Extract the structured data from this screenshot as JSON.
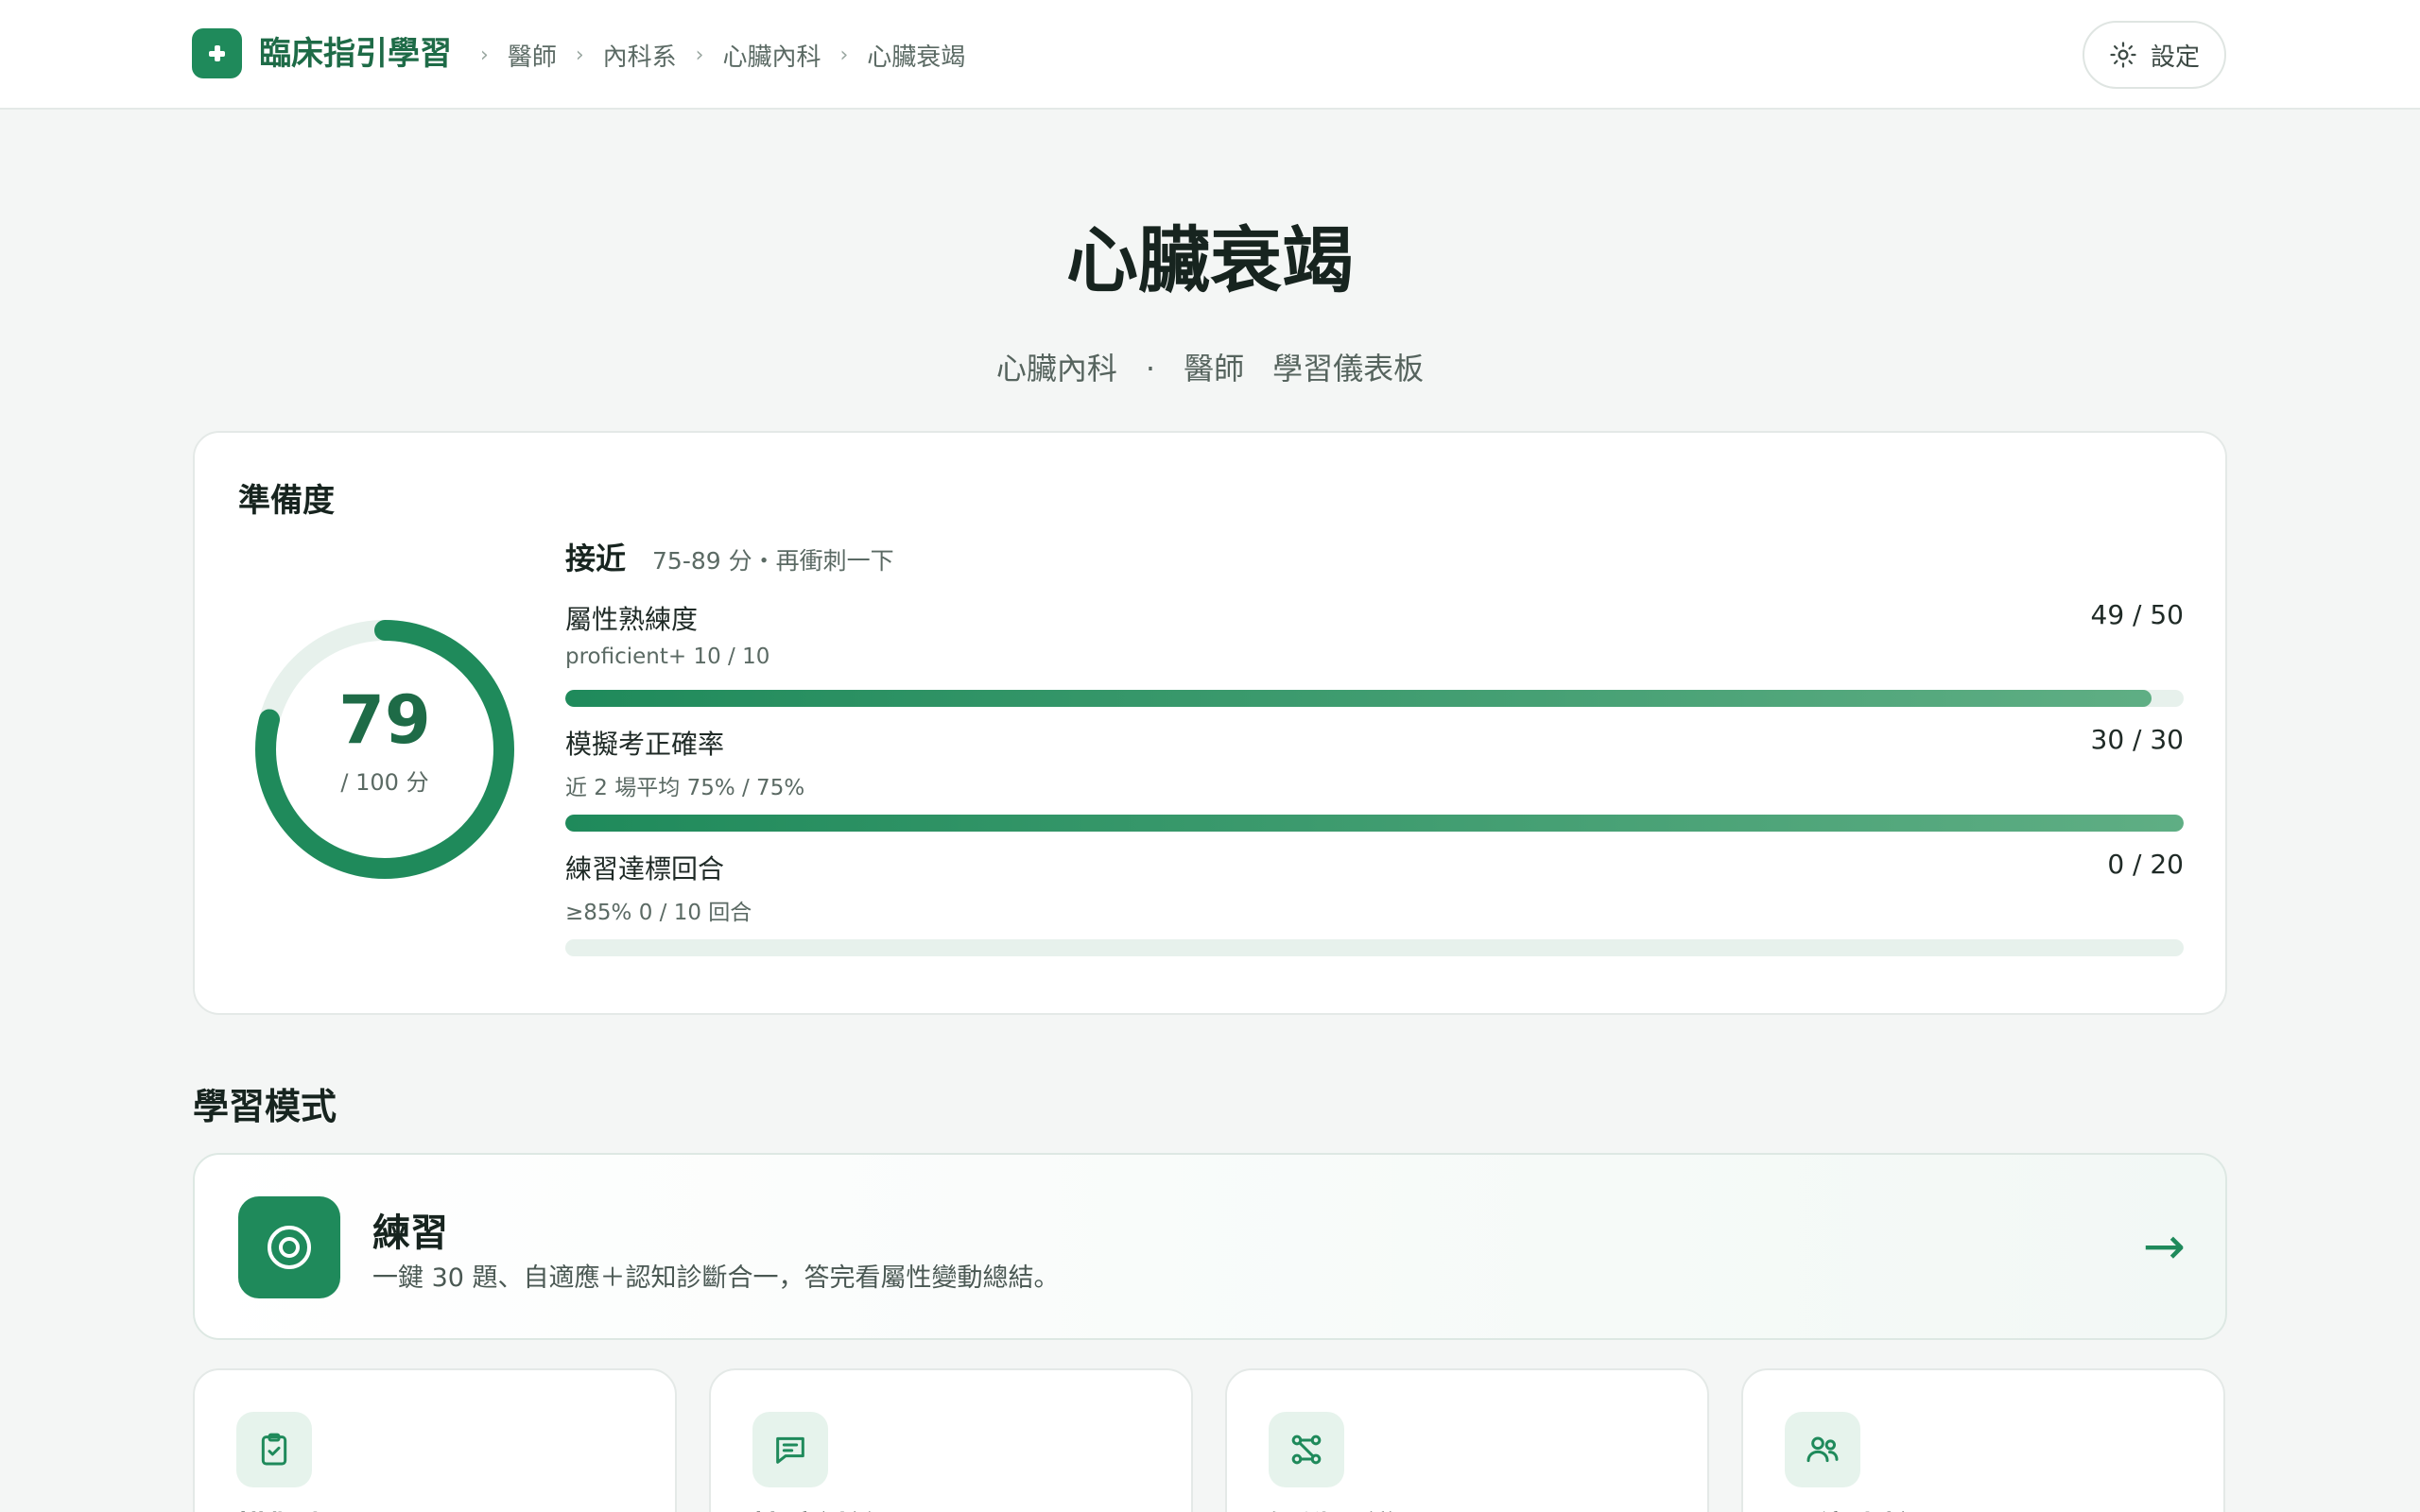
{
  "header": {
    "brand": "臨床指引學習",
    "breadcrumb": [
      "醫師",
      "內科系",
      "心臟內科",
      "心臟衰竭"
    ],
    "settings_label": "設定"
  },
  "hero": {
    "title": "心臟衰竭",
    "specialty": "心臟內科",
    "separator": "·",
    "role": "醫師",
    "dashboard": "學習儀表板"
  },
  "readiness": {
    "title": "準備度",
    "score": "79",
    "score_value": 79,
    "score_max": 100,
    "score_suffix": "/ 100 分",
    "level": "接近",
    "level_desc": "75-89 分・再衝刺一下",
    "metrics": [
      {
        "label": "屬性熟練度",
        "note": "proficient+ 10 / 10",
        "value": "49 / 50",
        "fraction": 0.98
      },
      {
        "label": "模擬考正確率",
        "note": "近 2 場平均 75% / 75%",
        "value": "30 / 30",
        "fraction": 1.0
      },
      {
        "label": "練習達標回合",
        "note": "≥85% 0 / 10 回合",
        "value": "0 / 20",
        "fraction": 0.0
      }
    ]
  },
  "modes": {
    "title": "學習模式",
    "practice": {
      "title": "練習",
      "desc": "一鍵 30 題、自適應＋認知診斷合一，答完看屬性變動總結。",
      "arrow": "→"
    },
    "cards": [
      {
        "label": "模擬考",
        "icon": "clipboard-check-icon"
      },
      {
        "label": "情境討論",
        "icon": "chat-icon"
      },
      {
        "label": "知識圖譜",
        "icon": "graph-icon"
      },
      {
        "label": "同儕比較",
        "icon": "people-icon"
      }
    ]
  },
  "colors": {
    "accent": "#1f8a5b",
    "accent_light": "#e6f3ec",
    "brand_text": "#1e6b47"
  }
}
